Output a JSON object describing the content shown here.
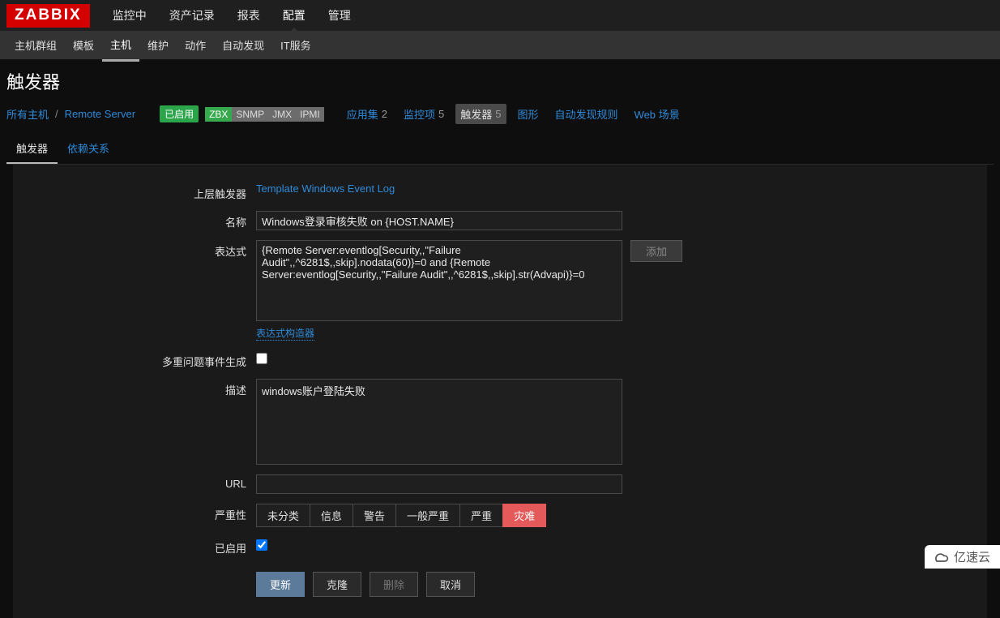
{
  "logo": "ZABBIX",
  "topnav": {
    "items": [
      "监控中",
      "资产记录",
      "报表",
      "配置",
      "管理"
    ],
    "active_index": 3
  },
  "subnav": {
    "items": [
      "主机群组",
      "模板",
      "主机",
      "维护",
      "动作",
      "自动发现",
      "IT服务"
    ],
    "active_index": 2
  },
  "page_title": "触发器",
  "breadcrumb": {
    "all_hosts": "所有主机",
    "sep": "/",
    "host": "Remote Server",
    "status": "已启用",
    "badges": {
      "zbx": "ZBX",
      "snmp": "SNMP",
      "jmx": "JMX",
      "ipmi": "IPMI"
    },
    "links": [
      {
        "label": "应用集",
        "count": "2",
        "active": false
      },
      {
        "label": "监控项",
        "count": "5",
        "active": false
      },
      {
        "label": "触发器",
        "count": "5",
        "active": true
      },
      {
        "label": "图形",
        "count": "",
        "active": false
      },
      {
        "label": "自动发现规则",
        "count": "",
        "active": false
      },
      {
        "label": "Web 场景",
        "count": "",
        "active": false
      }
    ]
  },
  "tabs": {
    "items": [
      "触发器",
      "依赖关系"
    ],
    "active_index": 0
  },
  "form": {
    "parent_trigger_label": "上层触发器",
    "parent_trigger_value": "Template Windows Event Log",
    "name_label": "名称",
    "name_value": "Windows登录审核失败 on {HOST.NAME}",
    "expression_label": "表达式",
    "expression_value": "{Remote Server:eventlog[Security,,\"Failure Audit\",,^6281$,,skip].nodata(60)}=0 and {Remote Server:eventlog[Security,,\"Failure Audit\",,^6281$,,skip].str(Advapi)}=0",
    "add_button": "添加",
    "expr_builder": "表达式构造器",
    "multi_event_label": "多重问题事件生成",
    "multi_event_checked": false,
    "description_label": "描述",
    "description_value": "windows账户登陆失败",
    "url_label": "URL",
    "url_value": "",
    "severity_label": "严重性",
    "severity_options": [
      "未分类",
      "信息",
      "警告",
      "一般严重",
      "严重",
      "灾难"
    ],
    "severity_selected": 5,
    "enabled_label": "已启用",
    "enabled_checked": true
  },
  "actions": {
    "update": "更新",
    "clone": "克隆",
    "delete": "删除",
    "cancel": "取消"
  },
  "watermark": "亿速云"
}
